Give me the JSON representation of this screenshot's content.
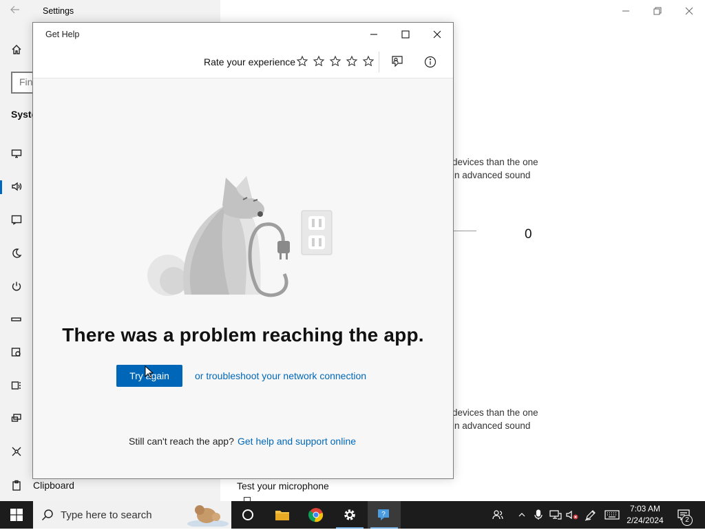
{
  "settings": {
    "title": "Settings",
    "search_placeholder": "Fin",
    "section_label": "Syste",
    "clipboard_label": "Clipboard",
    "bg_text_1_line1": "devices than the one",
    "bg_text_1_line2": "in advanced sound",
    "bg_text_2_line1": "devices than the one",
    "bg_text_2_line2": "in advanced sound",
    "slider_value": "0",
    "test_microphone": "Test your microphone"
  },
  "gethelp": {
    "title": "Get Help",
    "rate_label": "Rate your experience",
    "rating": 0,
    "stars": 5,
    "error_title": "There was a problem reaching the app.",
    "try_again": "Try again",
    "troubleshoot_link": "or troubleshoot your network connection",
    "still_text": "Still can't reach the app?",
    "online_link": "Get help and support online"
  },
  "taskbar": {
    "search_placeholder": "Type here to search",
    "apps": [
      "cortana-icon",
      "file-explorer-icon",
      "chrome-icon",
      "settings-icon",
      "get-help-icon"
    ],
    "clock_time": "7:03 AM",
    "clock_date": "2/24/2024",
    "notification_count": "2"
  },
  "colors": {
    "accent": "#0067b8",
    "taskbar": "#1c1c1c",
    "nav_bg": "#f2f2f2"
  }
}
